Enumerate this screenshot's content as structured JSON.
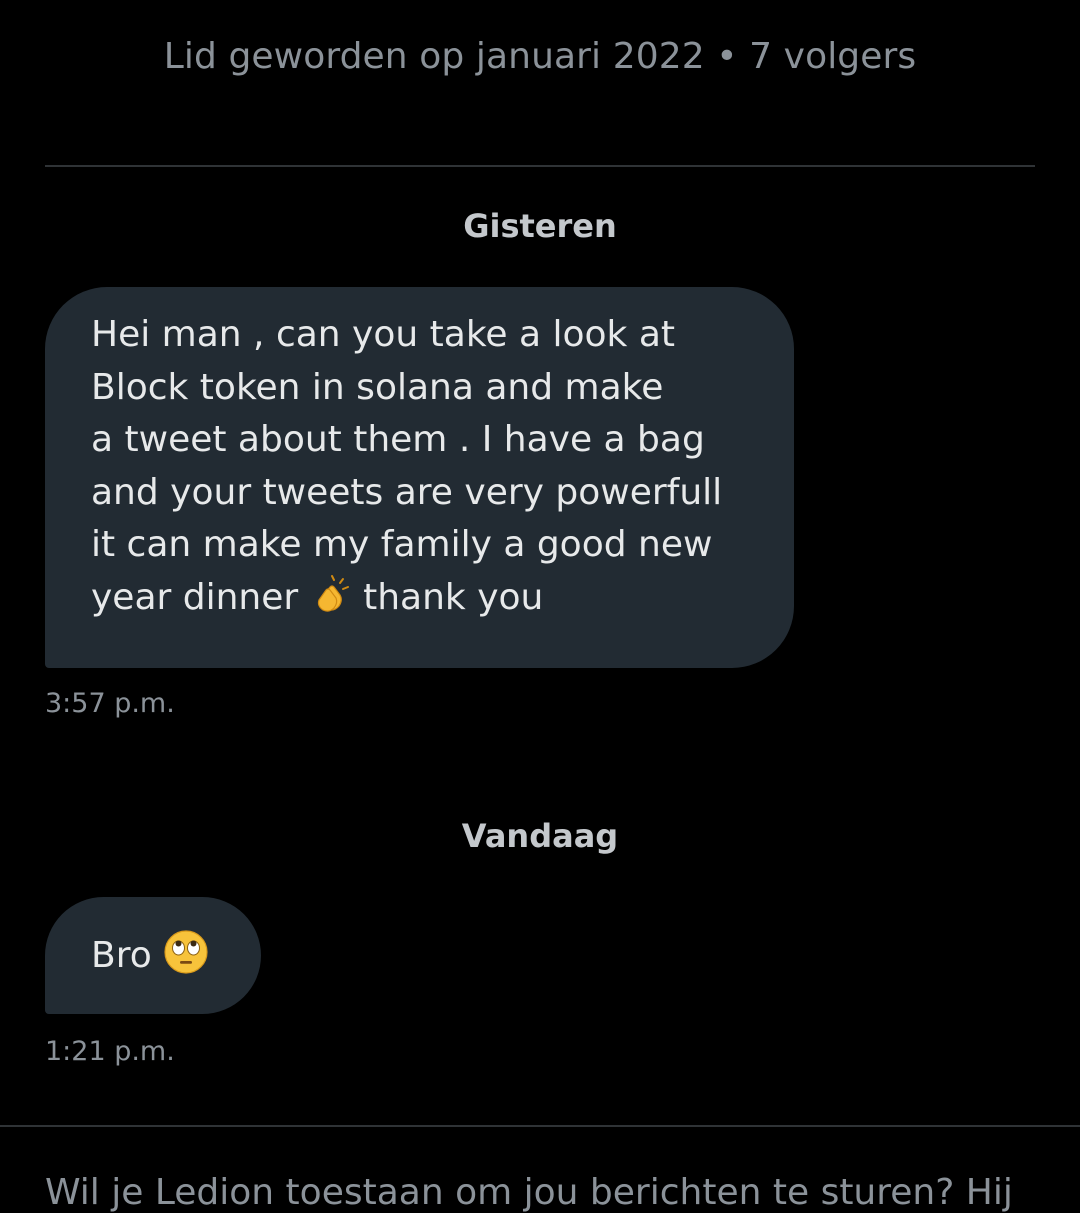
{
  "profile": {
    "meta": "Lid geworden op januari 2022 • 7 volgers"
  },
  "conversation": {
    "groups": [
      {
        "date_label": "Gisteren",
        "message": {
          "text": "Hei man , can you take a look at\nBlock token in solana and make\na tweet about them . I have a bag\nand your tweets are very powerfull\nit can make my family a good new\nyear dinner",
          "emoji": "clapping-hands-icon",
          "text_after": "thank you",
          "time": "3:57 p.m."
        }
      },
      {
        "date_label": "Vandaag",
        "message": {
          "text": "Bro",
          "emoji": "face-with-rolling-eyes-icon",
          "time": "1:21 p.m."
        }
      }
    ]
  },
  "request": {
    "text": "Wil je Ledion toestaan om jou berichten te sturen? Hij"
  },
  "colors": {
    "background": "#000000",
    "bubble": "#222b33",
    "secondary_text": "#8b9299",
    "divider": "#2f3336"
  }
}
